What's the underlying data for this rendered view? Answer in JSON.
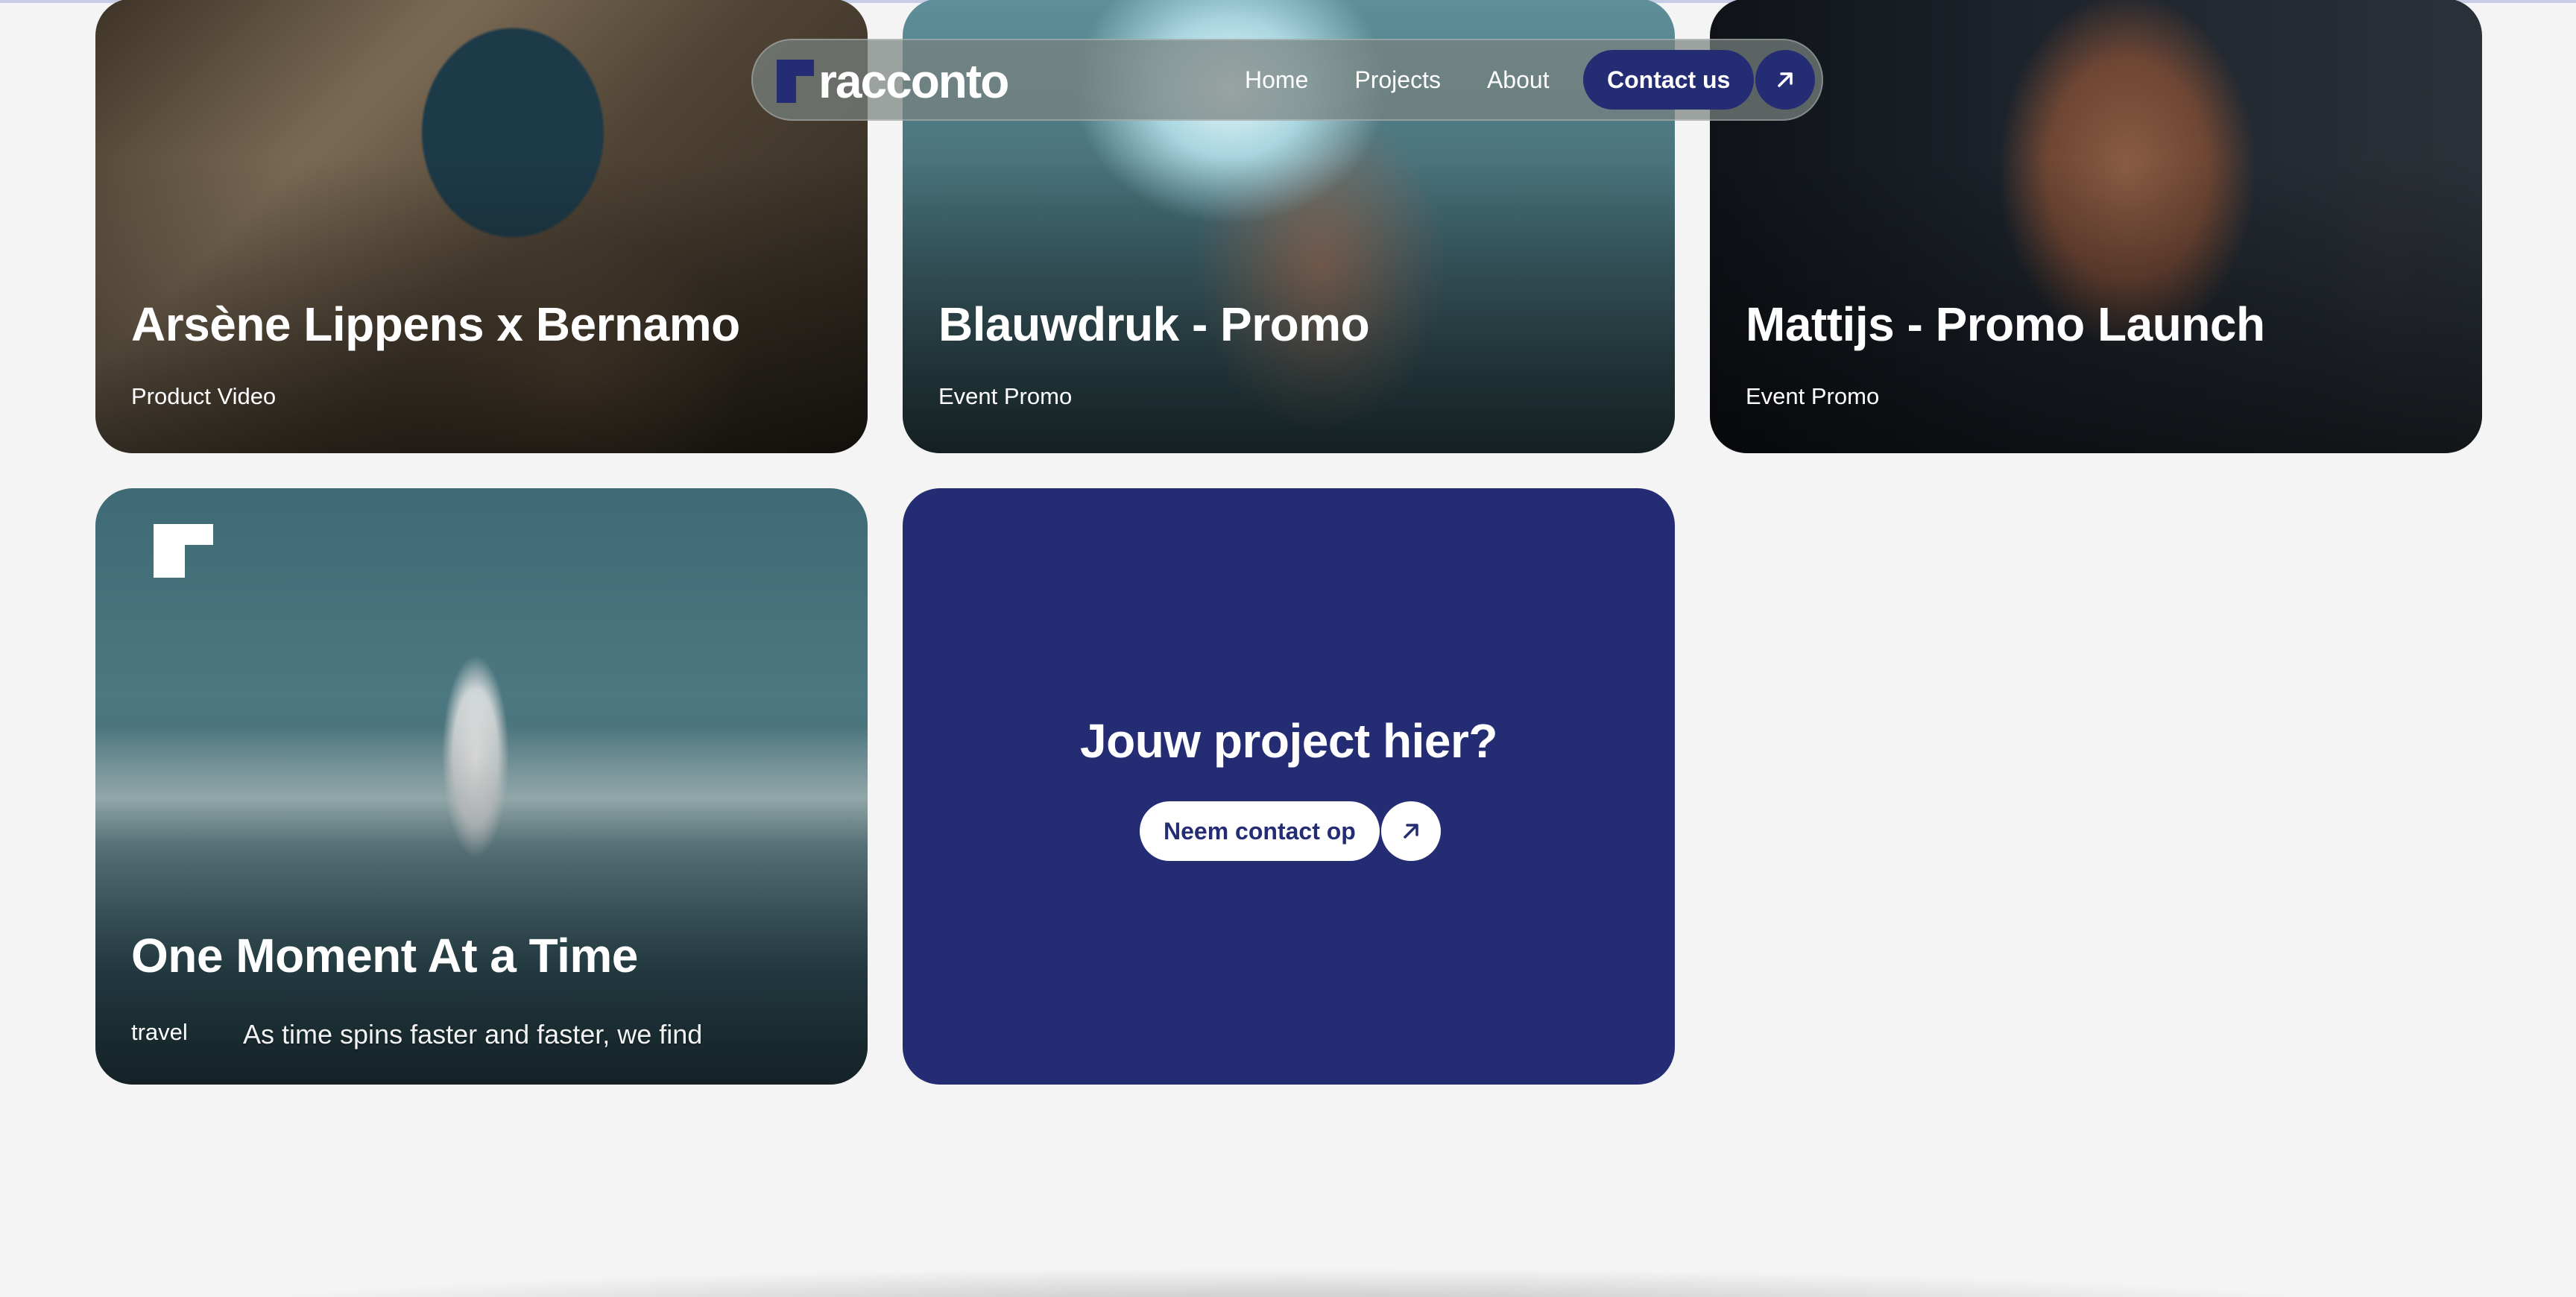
{
  "nav": {
    "brand": "racconto",
    "links": [
      "Home",
      "Projects",
      "About"
    ],
    "cta_label": "Contact us"
  },
  "projects": [
    {
      "title": "Arsène Lippens x Bernamo",
      "category": "Product Video"
    },
    {
      "title": "Blauwdruk - Promo",
      "category": "Event Promo"
    },
    {
      "title": "Mattijs - Promo Launch",
      "category": "Event Promo"
    },
    {
      "title": "One Moment At a Time",
      "category": "travel",
      "subtitle": "As time spins faster and faster, we find"
    }
  ],
  "cta_card": {
    "title": "Jouw project hier?",
    "button_label": "Neem contact op"
  },
  "colors": {
    "accent": "#242c73",
    "background": "#f4f4f4"
  }
}
